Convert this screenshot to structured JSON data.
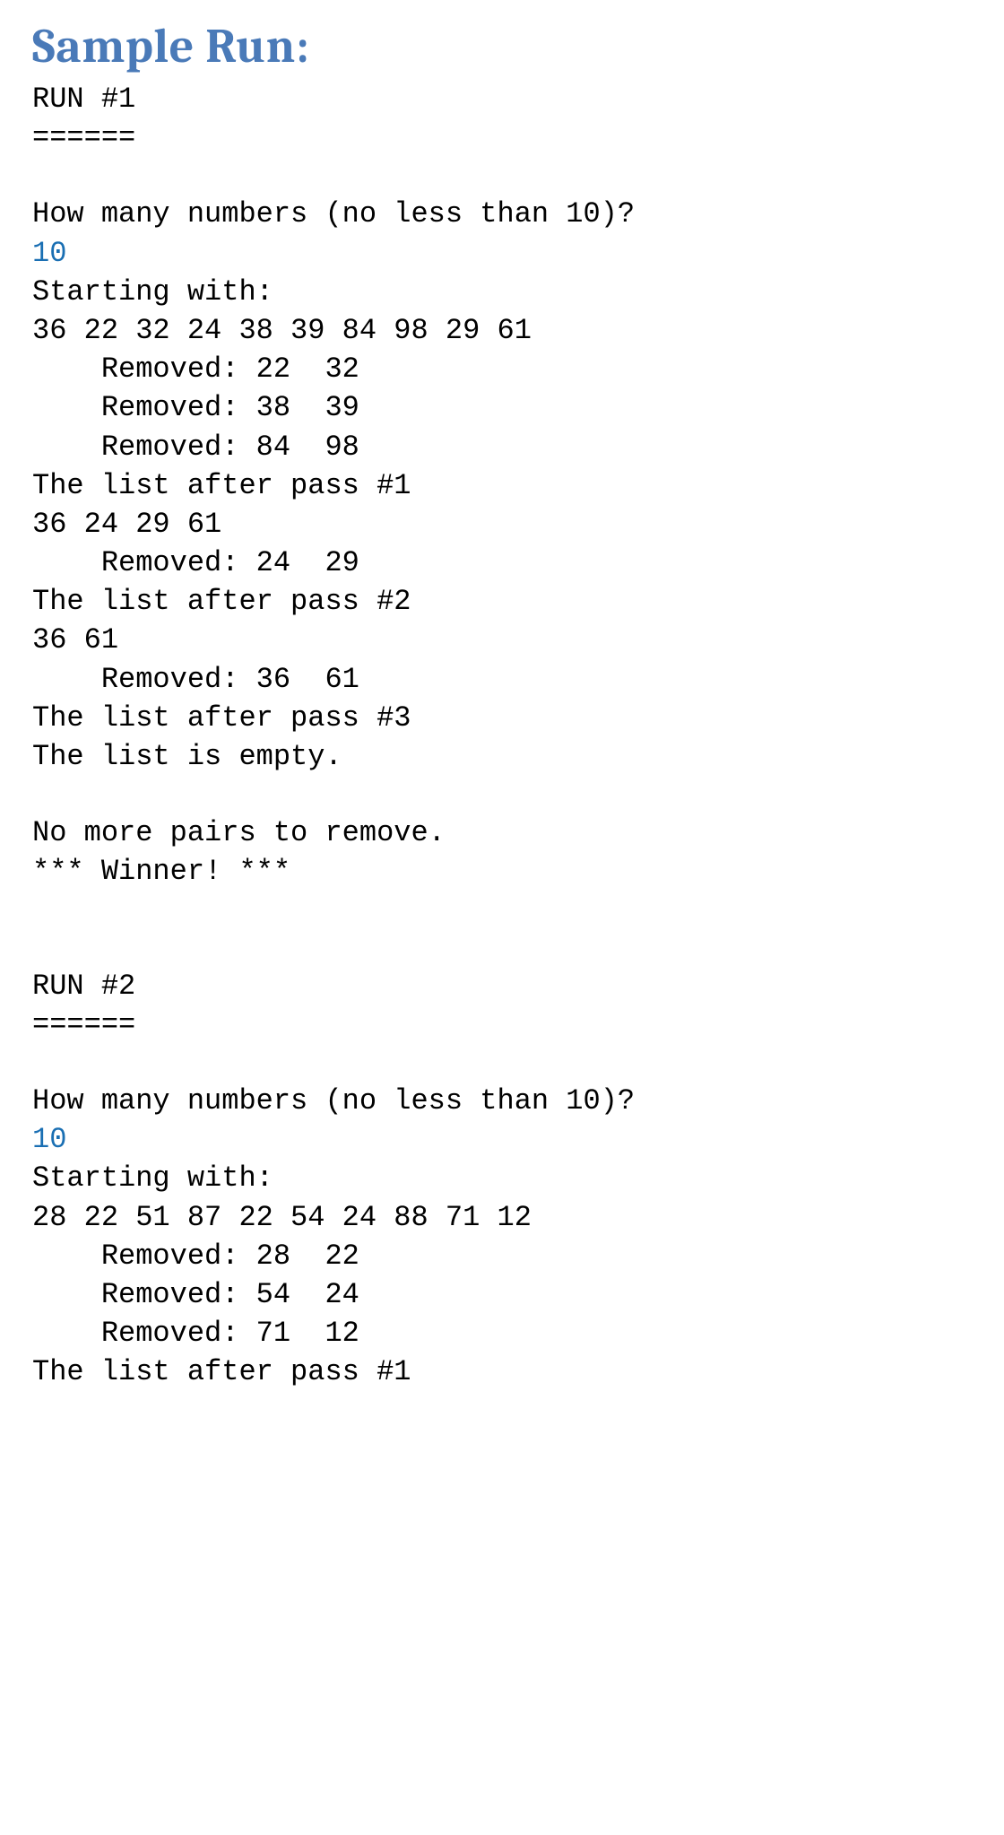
{
  "heading": "Sample Run:",
  "run1": {
    "title": "RUN #1",
    "rule": "======",
    "prompt": "How many numbers (no less than 10)?",
    "input": "10",
    "starting_label": "Starting with:",
    "starting_list": "36 22 32 24 38 39 84 98 29 61",
    "removed": [
      "    Removed: 22  32",
      "    Removed: 38  39",
      "    Removed: 84  98"
    ],
    "pass1_label": "The list after pass #1",
    "pass1_list": "36 24 29 61",
    "removed2": [
      "    Removed: 24  29"
    ],
    "pass2_label": "The list after pass #2",
    "pass2_list": "36 61",
    "removed3": [
      "    Removed: 36  61"
    ],
    "pass3_label": "The list after pass #3",
    "empty_msg": "The list is empty.",
    "nomore": "No more pairs to remove.",
    "winner": "*** Winner! ***"
  },
  "run2": {
    "title": "RUN #2",
    "rule": "======",
    "prompt": "How many numbers (no less than 10)?",
    "input": "10",
    "starting_label": "Starting with:",
    "starting_list": "28 22 51 87 22 54 24 88 71 12",
    "removed": [
      "    Removed: 28  22",
      "    Removed: 54  24",
      "    Removed: 71  12"
    ],
    "pass1_label": "The list after pass #1"
  }
}
